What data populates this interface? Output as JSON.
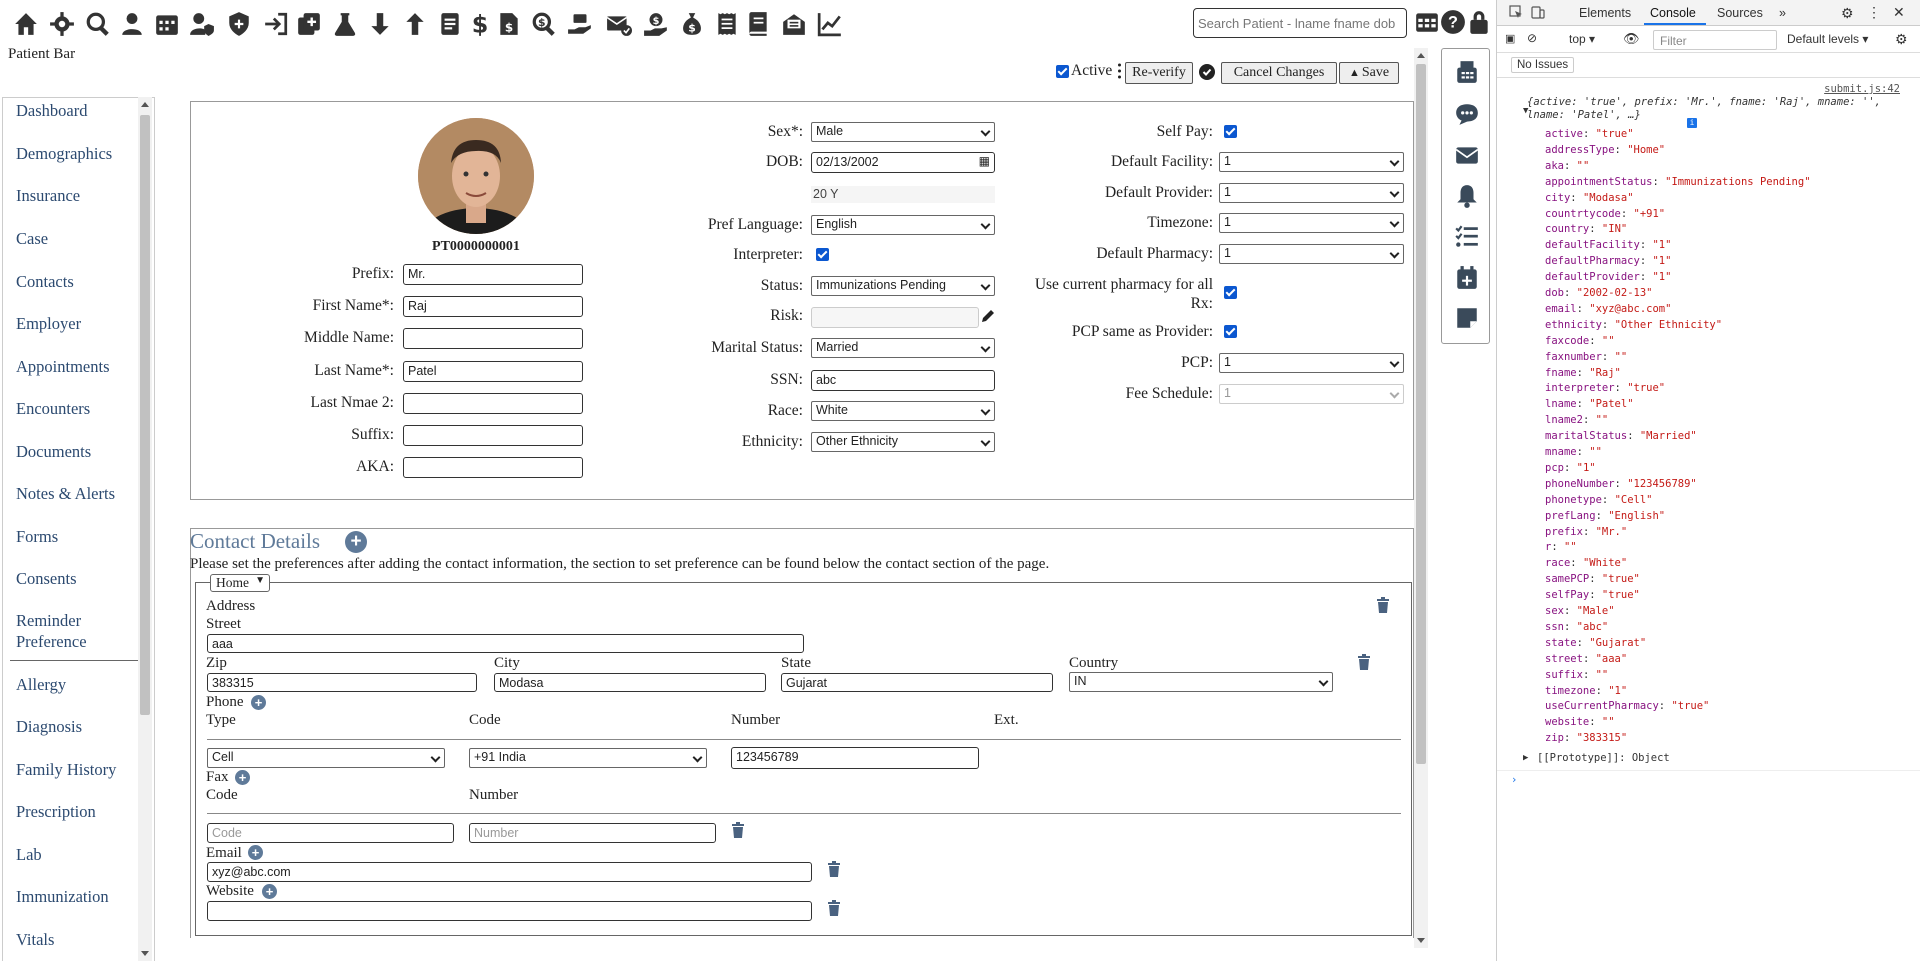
{
  "toolbar": {
    "icons": [
      "home-icon",
      "gear-icon",
      "search-icon",
      "user-icon",
      "calendar-icon",
      "user-shield-icon",
      "shield-icon",
      "sign-in-icon",
      "add-document-icon",
      "flask-icon",
      "arrow-down-icon",
      "arrow-up-icon",
      "document-icon",
      "dollar-icon",
      "file-invoice-icon",
      "search-dollar-icon",
      "hand-holding-icon",
      "mail-check-icon",
      "hand-dollar-icon",
      "money-bag-icon",
      "receipt-icon",
      "book-icon",
      "mail-open-icon",
      "chart-line-icon"
    ],
    "search_placeholder": "Search Patient - lname fname dob",
    "right_icons": [
      "calendar-table-icon",
      "help-icon",
      "lock-icon"
    ]
  },
  "patient_bar_label": "Patient Bar",
  "sidebar": {
    "items": [
      "Dashboard",
      "Demographics",
      "Insurance",
      "Case",
      "Contacts",
      "Employer",
      "Appointments",
      "Encounters",
      "Documents",
      "Notes & Alerts",
      "Forms",
      "Consents",
      "Reminder Preference",
      "Allergy",
      "Diagnosis",
      "Family History",
      "Prescription",
      "Lab",
      "Immunization",
      "Vitals"
    ]
  },
  "header_actions": {
    "active_label": "Active",
    "reverify_label": "Re-verify",
    "cancel_label": "Cancel Changes",
    "save_label": "Save"
  },
  "patient": {
    "id": "PT0000000001",
    "prefix_label": "Prefix:",
    "prefix": "Mr.",
    "first_name_label": "First Name*:",
    "first_name": "Raj",
    "middle_name_label": "Middle Name:",
    "middle_name": "",
    "last_name_label": "Last Name*:",
    "last_name": "Patel",
    "last_name2_label": "Last Nmae 2:",
    "last_name2": "",
    "suffix_label": "Suffix:",
    "suffix": "",
    "aka_label": "AKA:",
    "aka": "",
    "sex_label": "Sex*:",
    "sex": "Male",
    "dob_label": "DOB:",
    "dob": "02/13/2002",
    "age": "20 Y",
    "pref_language_label": "Pref Language:",
    "pref_language": "English",
    "interpreter_label": "Interpreter:",
    "status_label": "Status:",
    "status": "Immunizations Pending",
    "risk_label": "Risk:",
    "risk": "",
    "marital_status_label": "Marital Status:",
    "marital_status": "Married",
    "ssn_label": "SSN:",
    "ssn": "abc",
    "race_label": "Race:",
    "race": "White",
    "ethnicity_label": "Ethnicity:",
    "ethnicity": "Other Ethnicity",
    "self_pay_label": "Self Pay:",
    "default_facility_label": "Default Facility:",
    "default_facility": "1",
    "default_provider_label": "Default Provider:",
    "default_provider": "1",
    "timezone_label": "Timezone:",
    "timezone": "1",
    "default_pharmacy_label": "Default Pharmacy:",
    "default_pharmacy": "1",
    "use_current_pharmacy_label": "Use current pharmacy for all Rx:",
    "pcp_same_label": "PCP same as Provider:",
    "pcp_label": "PCP:",
    "pcp": "1",
    "fee_schedule_label": "Fee Schedule:",
    "fee_schedule": "1"
  },
  "contact": {
    "title": "Contact Details",
    "note": "Please set the preferences after adding the contact information, the section to set preference can be found below the contact section of the page.",
    "address_type": "Home",
    "address_label": "Address",
    "street_label": "Street",
    "street": "aaa",
    "zip_label": "Zip",
    "zip": "383315",
    "city_label": "City",
    "city": "Modasa",
    "state_label": "State",
    "state": "Gujarat",
    "country_label": "Country",
    "country": "IN",
    "phone_label": "Phone",
    "phone_type_label": "Type",
    "phone_code_label": "Code",
    "phone_number_label": "Number",
    "phone_ext_label": "Ext.",
    "phone_type": "Cell",
    "phone_code": "+91 India",
    "phone_number": "123456789",
    "fax_label": "Fax",
    "fax_code_label": "Code",
    "fax_number_label": "Number",
    "fax_code_placeholder": "Code",
    "fax_number_placeholder": "Number",
    "email_label": "Email",
    "email": "xyz@abc.com",
    "website_label": "Website",
    "website": ""
  },
  "devtools": {
    "tabs": [
      "Elements",
      "Console",
      "Sources"
    ],
    "context": "top",
    "filter_placeholder": "Filter",
    "levels": "Default levels",
    "issues": "No Issues",
    "source_link": "submit.js:42",
    "summary": "{active: 'true', prefix: 'Mr.', fname: 'Raj', mname: '', lname: 'Patel', …}",
    "props": [
      [
        "active",
        "\"true\""
      ],
      [
        "addressType",
        "\"Home\""
      ],
      [
        "aka",
        "\"\""
      ],
      [
        "appointmentStatus",
        "\"Immunizations Pending\""
      ],
      [
        "city",
        "\"Modasa\""
      ],
      [
        "countrtycode",
        "\"+91\""
      ],
      [
        "country",
        "\"IN\""
      ],
      [
        "defaultFacility",
        "\"1\""
      ],
      [
        "defaultPharmacy",
        "\"1\""
      ],
      [
        "defaultProvider",
        "\"1\""
      ],
      [
        "dob",
        "\"2002-02-13\""
      ],
      [
        "email",
        "\"xyz@abc.com\""
      ],
      [
        "ethnicity",
        "\"Other Ethnicity\""
      ],
      [
        "faxcode",
        "\"\""
      ],
      [
        "faxnumber",
        "\"\""
      ],
      [
        "fname",
        "\"Raj\""
      ],
      [
        "interpreter",
        "\"true\""
      ],
      [
        "lname",
        "\"Patel\""
      ],
      [
        "lname2",
        "\"\""
      ],
      [
        "maritalStatus",
        "\"Married\""
      ],
      [
        "mname",
        "\"\""
      ],
      [
        "pcp",
        "\"1\""
      ],
      [
        "phoneNumber",
        "\"123456789\""
      ],
      [
        "phonetype",
        "\"Cell\""
      ],
      [
        "prefLang",
        "\"English\""
      ],
      [
        "prefix",
        "\"Mr.\""
      ],
      [
        "r",
        "\"\""
      ],
      [
        "race",
        "\"White\""
      ],
      [
        "samePCP",
        "\"true\""
      ],
      [
        "selfPay",
        "\"true\""
      ],
      [
        "sex",
        "\"Male\""
      ],
      [
        "ssn",
        "\"abc\""
      ],
      [
        "state",
        "\"Gujarat\""
      ],
      [
        "street",
        "\"aaa\""
      ],
      [
        "suffix",
        "\"\""
      ],
      [
        "timezone",
        "\"1\""
      ],
      [
        "useCurrentPharmacy",
        "\"true\""
      ],
      [
        "website",
        "\"\""
      ],
      [
        "zip",
        "\"383315\""
      ]
    ],
    "prototype": "[[Prototype]]: Object"
  }
}
